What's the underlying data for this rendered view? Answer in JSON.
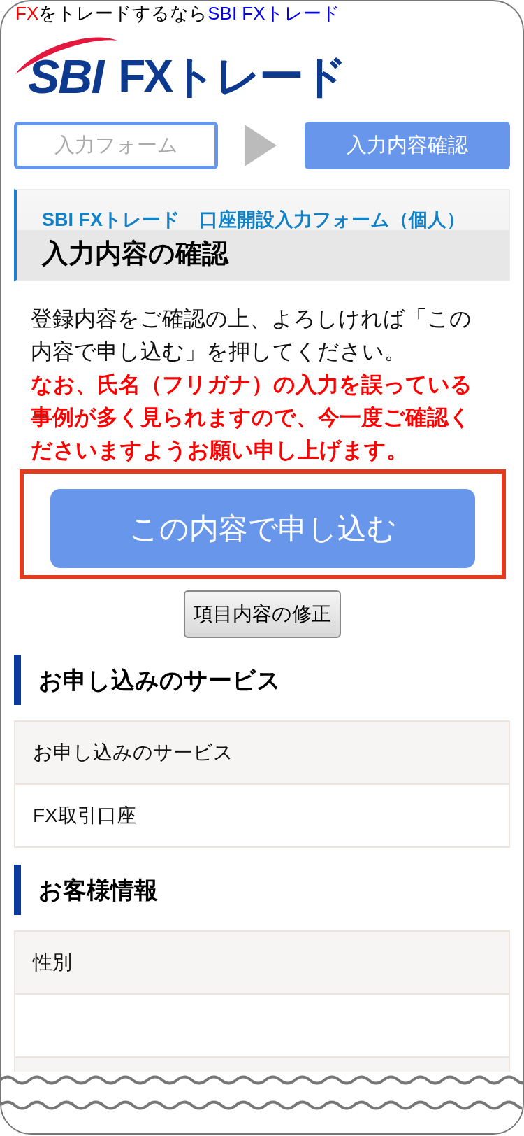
{
  "tagline": [
    {
      "text": "FX",
      "kind": "accent"
    },
    {
      "text": "をトレードするなら",
      "kind": "plain"
    },
    {
      "text": "SBI FXトレード",
      "kind": "link"
    }
  ],
  "logo": {
    "mark": "SBI",
    "name": "FXトレード"
  },
  "steps": [
    {
      "label": "入力フォーム",
      "selected": false
    },
    {
      "label": "入力内容確認",
      "selected": true
    }
  ],
  "page_header": {
    "subtitle": "SBI FXトレード　口座開設入力フォーム（個人）",
    "title": "入力内容の確認"
  },
  "instructions": [
    {
      "text": "登録内容をご確認の上、よろしければ「この内容で申し込む」を押してください。",
      "kind": "normal"
    },
    {
      "text": "なお、氏名（フリガナ）の入力を誤っている事例が多く見られますので、今一度ご確認くださいますようお願い申し上げます。",
      "kind": "warning"
    }
  ],
  "submit_button": "この内容で申し込む",
  "edit_button": "項目内容の修正",
  "sections": [
    {
      "title": "お申し込みのサービス",
      "rows": [
        {
          "label": "お申し込みのサービス",
          "value": "FX取引口座"
        }
      ]
    },
    {
      "title": "お客様情報",
      "rows": [
        {
          "label": "性別"
        },
        {}
      ]
    }
  ]
}
